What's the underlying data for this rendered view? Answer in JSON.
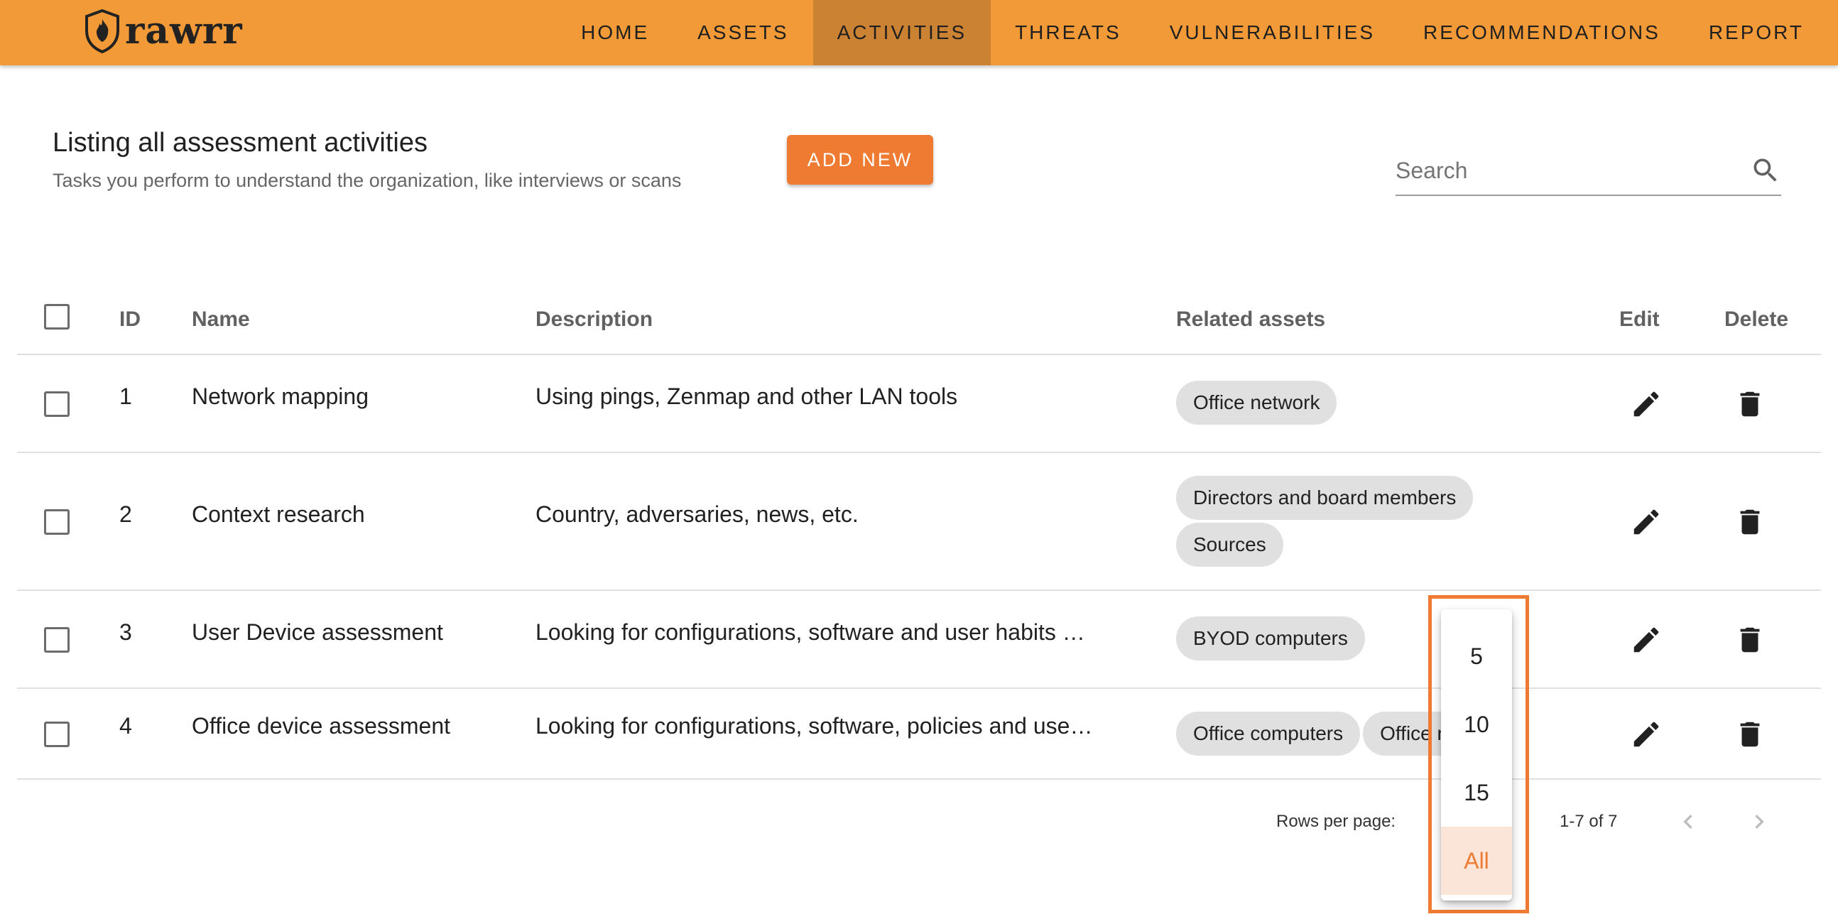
{
  "brand": {
    "name": "rawrr"
  },
  "nav": {
    "items": [
      "HOME",
      "ASSETS",
      "ACTIVITIES",
      "THREATS",
      "VULNERABILITIES",
      "RECOMMENDATIONS",
      "REPORT"
    ],
    "active": "ACTIVITIES"
  },
  "header": {
    "title": "Listing all assessment activities",
    "subtitle": "Tasks you perform to understand the organization, like interviews or scans",
    "add_label": "ADD NEW"
  },
  "search": {
    "placeholder": "Search"
  },
  "table": {
    "columns": {
      "id": "ID",
      "name": "Name",
      "description": "Description",
      "assets": "Related assets",
      "edit": "Edit",
      "delete": "Delete"
    },
    "rows": [
      {
        "id": "1",
        "name": "Network mapping",
        "description": "Using pings, Zenmap and other LAN tools",
        "assets": [
          "Office network"
        ]
      },
      {
        "id": "2",
        "name": "Context research",
        "description": "Country, adversaries, news, etc.",
        "assets": [
          "Directors and board members",
          "Sources"
        ]
      },
      {
        "id": "3",
        "name": "User Device assessment",
        "description": "Looking for configurations, software and user habits …",
        "assets": [
          "BYOD computers"
        ]
      },
      {
        "id": "4",
        "name": "Office device assessment",
        "description": "Looking for configurations, software, policies and use…",
        "assets": [
          "Office computers",
          "Office n"
        ]
      }
    ]
  },
  "pagination": {
    "rows_per_page_label": "Rows per page:",
    "range": "1-7 of 7",
    "options": [
      "5",
      "10",
      "15",
      "All"
    ],
    "selected": "All"
  },
  "colors": {
    "appbar": "#f29a37",
    "active_tab": "#cc8233",
    "accent": "#ef7b33",
    "chip": "#e0e0e0"
  }
}
